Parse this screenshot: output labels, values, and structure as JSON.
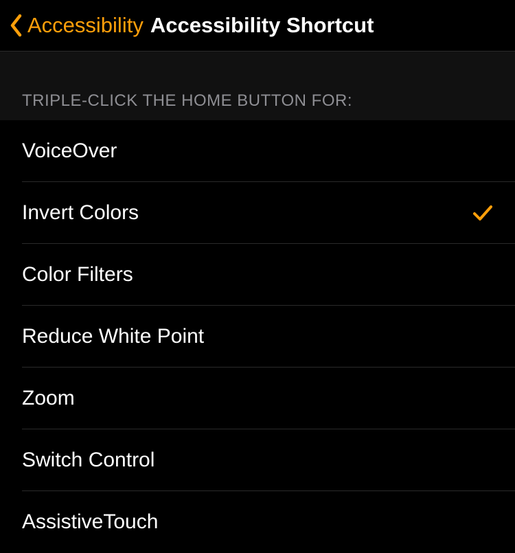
{
  "header": {
    "back_label": "Accessibility",
    "title": "Accessibility Shortcut"
  },
  "section": {
    "header": "TRIPLE-CLICK THE HOME BUTTON FOR:"
  },
  "items": [
    {
      "label": "VoiceOver",
      "checked": false
    },
    {
      "label": "Invert Colors",
      "checked": true
    },
    {
      "label": "Color Filters",
      "checked": false
    },
    {
      "label": "Reduce White Point",
      "checked": false
    },
    {
      "label": "Zoom",
      "checked": false
    },
    {
      "label": "Switch Control",
      "checked": false
    },
    {
      "label": "AssistiveTouch",
      "checked": false
    }
  ],
  "colors": {
    "accent": "#ff9f0a"
  }
}
